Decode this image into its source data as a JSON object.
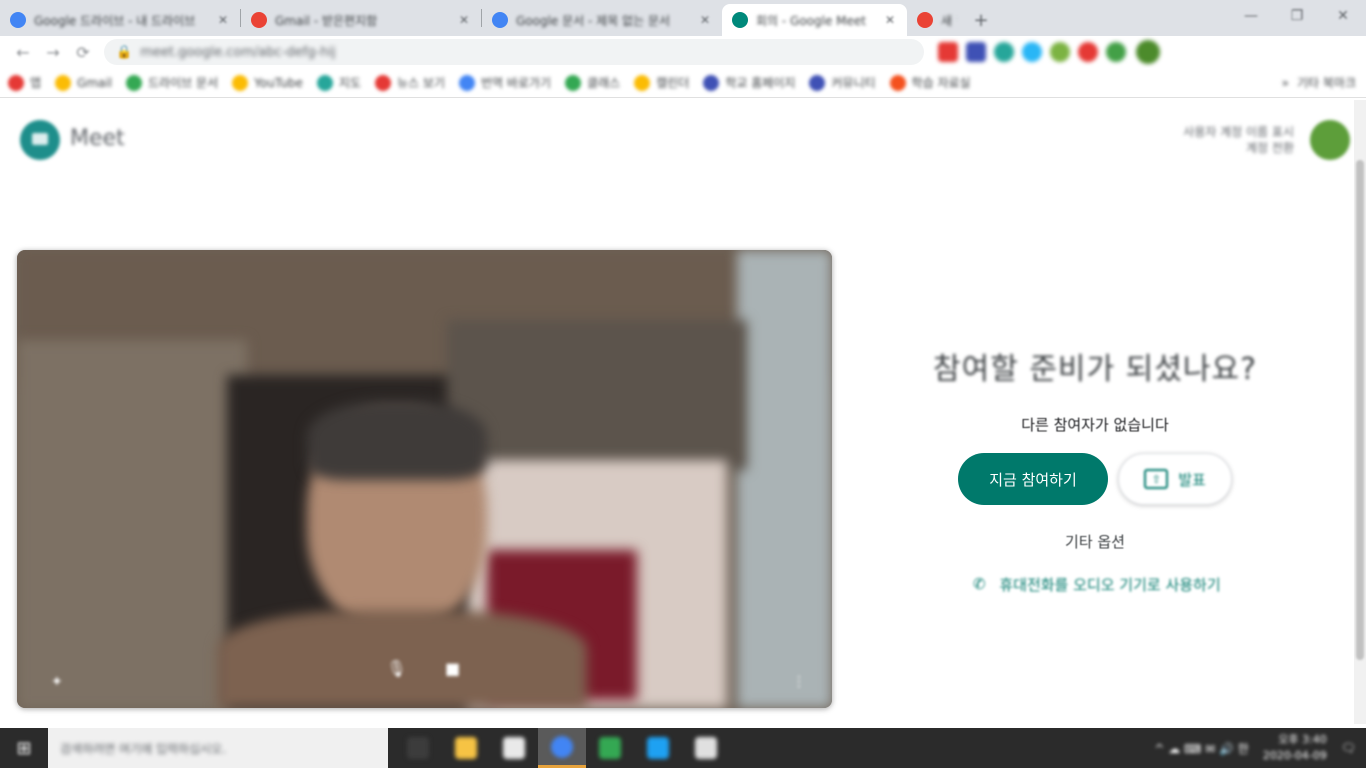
{
  "browser": {
    "tabs": [
      {
        "title": "Google 드라이브 - 내 드라이브",
        "favicon_color": "#4285f4",
        "active": false
      },
      {
        "title": "Gmail - 받은편지함",
        "favicon_color": "#ea4335",
        "active": false
      },
      {
        "title": "Google 문서 - 제목 없는 문서",
        "favicon_color": "#4285f4",
        "active": false
      },
      {
        "title": "회의 - Google Meet",
        "favicon_color": "#00897b",
        "active": true
      },
      {
        "title": "새 탭",
        "favicon_color": "#ea4335",
        "active": false
      }
    ],
    "newtab_glyph": "+",
    "window_controls": [
      "—",
      "❐",
      "✕"
    ],
    "nav": {
      "back": "←",
      "forward": "→",
      "reload": "⟳"
    },
    "omnibox": {
      "lock_glyph": "🔒",
      "url": "meet.google.com/abc-defg-hij"
    },
    "extension_colors": [
      "#e53935",
      "#3f51b5",
      "#26a69a",
      "#29b6f6",
      "#7cb342",
      "#e53935",
      "#43a047"
    ],
    "bookmarks": [
      {
        "label": "앱",
        "color": "#e53935"
      },
      {
        "label": "Gmail",
        "color": "#fbbc04"
      },
      {
        "label": "드라이브 문서",
        "color": "#34a853"
      },
      {
        "label": "YouTube",
        "color": "#fbbc04"
      },
      {
        "label": "지도",
        "color": "#26a69a"
      },
      {
        "label": "뉴스 보기",
        "color": "#e53935"
      },
      {
        "label": "번역 바로가기",
        "color": "#4285f4"
      },
      {
        "label": "클래스",
        "color": "#34a853"
      },
      {
        "label": "캘린더",
        "color": "#fbbc04"
      },
      {
        "label": "학교 홈페이지",
        "color": "#3f51b5"
      },
      {
        "label": "커뮤니티",
        "color": "#3f51b5"
      },
      {
        "label": "학습 자료실",
        "color": "#f4511e"
      }
    ],
    "bookmarks_right": {
      "more": "»",
      "other": "기타 북마크"
    }
  },
  "meet": {
    "product_name": "Meet",
    "account": {
      "line1": "사용자 계정 이름 표시",
      "line2": "계정 전환"
    },
    "join_title": "참여할 준비가 되셨나요?",
    "participants_text": "다른 참여자가 없습니다",
    "join_button": "지금 참여하기",
    "present_button": "발표",
    "present_glyph": "⇧",
    "other_options": "기타 옵션",
    "phone_link": "휴대전화를 오디오 기기로 사용하기",
    "phone_glyph": "✆",
    "video_controls": {
      "mic": "🎙",
      "cam": "■",
      "more": "⋮",
      "effects": "✦"
    }
  },
  "taskbar": {
    "start_glyph": "⊞",
    "search_placeholder": "검색하려면 여기에 입력하십시오.",
    "apps": [
      {
        "color": "#3c3c3c",
        "active": false
      },
      {
        "color": "#f6c344",
        "active": false
      },
      {
        "color": "#e9e9e9",
        "active": false
      },
      {
        "color": "#4285f4",
        "active": true
      },
      {
        "color": "#34a853",
        "active": false
      },
      {
        "color": "#1ea1f2",
        "active": false
      },
      {
        "color": "#e0e0e0",
        "active": false
      }
    ],
    "tray": {
      "icons": "^ ☁ ⌨ ✉ 🔊 한",
      "time": "오후 3:40",
      "date": "2020-04-09",
      "notify": "🗨"
    }
  }
}
